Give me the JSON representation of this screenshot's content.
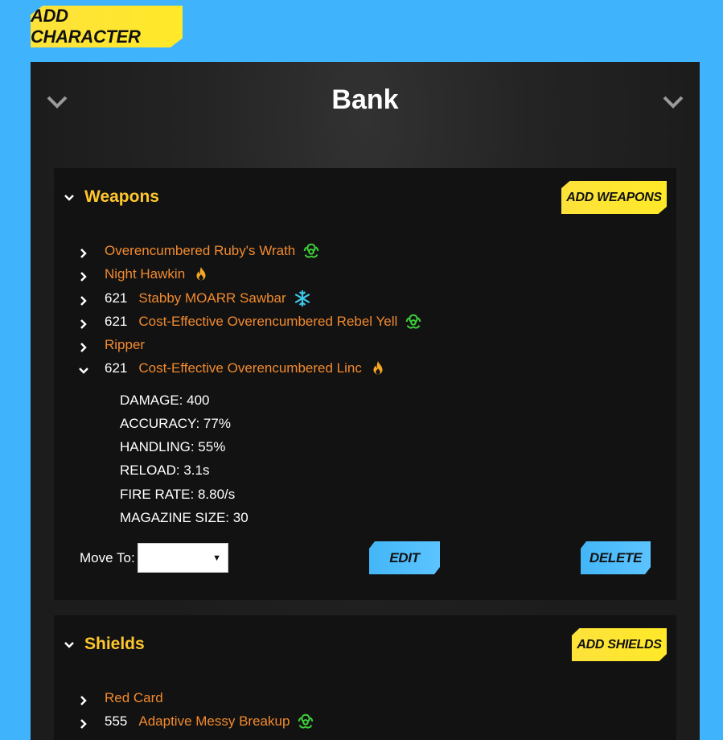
{
  "toolbar": {
    "add_character_label": "ADD CHARACTER"
  },
  "bank": {
    "title": "Bank",
    "weapons": {
      "title": "Weapons",
      "add_label": "ADD WEAPONS",
      "items": [
        {
          "level": "",
          "name": "Overencumbered Ruby's Wrath",
          "element": "corrosive-icon",
          "expanded": false
        },
        {
          "level": "",
          "name": "Night Hawkin",
          "element": "fire-icon",
          "expanded": false
        },
        {
          "level": "621",
          "name": "Stabby MOARR Sawbar",
          "element": "cryo-icon",
          "expanded": false
        },
        {
          "level": "621",
          "name": "Cost-Effective Overencumbered Rebel Yell",
          "element": "corrosive-icon",
          "expanded": false
        },
        {
          "level": "",
          "name": "Ripper",
          "element": "",
          "expanded": false
        },
        {
          "level": "621",
          "name": "Cost-Effective Overencumbered Linc",
          "element": "fire-icon",
          "expanded": true
        }
      ],
      "stats": [
        "DAMAGE: 400",
        "ACCURACY: 77%",
        "HANDLING: 55%",
        "RELOAD: 3.1s",
        "FIRE RATE: 8.80/s",
        "MAGAZINE SIZE: 30"
      ],
      "move_to_label": "Move To:",
      "move_to_value": "",
      "edit_label": "EDIT",
      "delete_label": "DELETE"
    },
    "shields": {
      "title": "Shields",
      "add_label": "ADD SHIELDS",
      "items": [
        {
          "level": "",
          "name": "Red Card",
          "element": ""
        },
        {
          "level": "555",
          "name": "Adaptive Messy Breakup",
          "element": "corrosive-icon"
        }
      ]
    }
  },
  "colors": {
    "background": "#3fb3fb",
    "accent_yellow": "#ffe928",
    "item_orange": "#f28a2e",
    "title_gold": "#ffc72c",
    "corrosive": "#3ecf3a",
    "fire": "#f5a623",
    "cryo": "#3cc8e8"
  }
}
